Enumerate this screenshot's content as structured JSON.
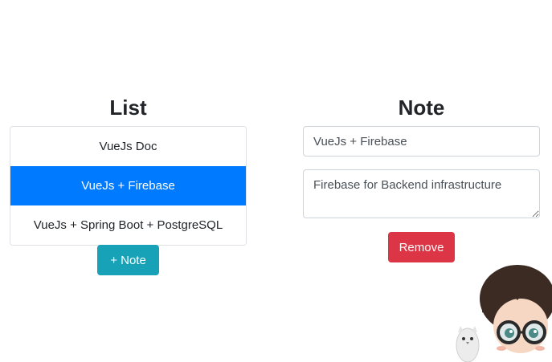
{
  "list": {
    "heading": "List",
    "items": [
      {
        "label": "VueJs Doc",
        "active": false
      },
      {
        "label": "VueJs + Firebase",
        "active": true
      },
      {
        "label": "VueJs + Spring Boot + PostgreSQL",
        "active": false
      }
    ],
    "add_button_label": "+ Note"
  },
  "note": {
    "heading": "Note",
    "title_value": "VueJs + Firebase",
    "body_value": "Firebase for Backend infrastructure",
    "remove_button_label": "Remove"
  },
  "colors": {
    "active_item": "#007bff",
    "add_button": "#17a2b8",
    "remove_button": "#dc3545"
  },
  "decoration": {
    "mascot_icon": "chibi-wizard-with-owl"
  }
}
